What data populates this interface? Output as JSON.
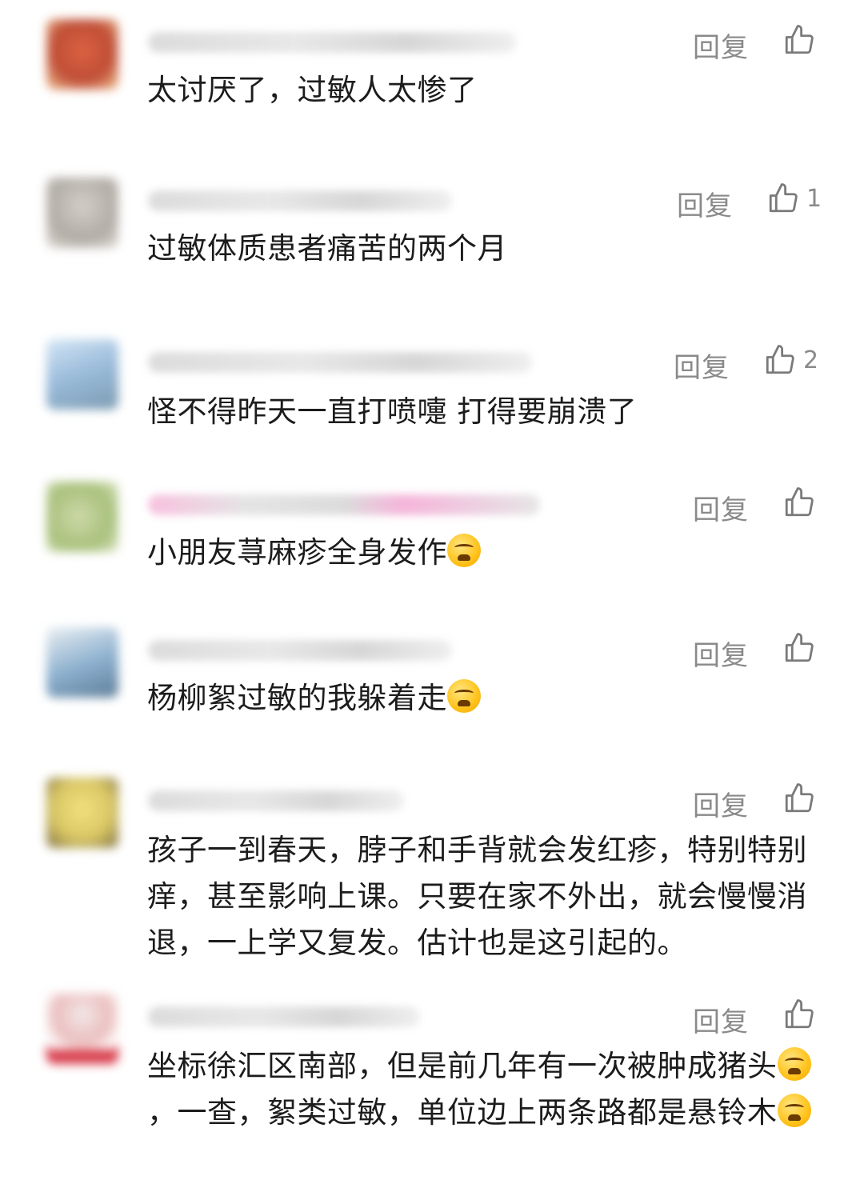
{
  "reply_label": "回复",
  "comments": [
    {
      "text": "太讨厌了，过敏人太惨了",
      "likes": "",
      "avatar_color": "#c0452c"
    },
    {
      "text": "过敏体质患者痛苦的两个月",
      "likes": "1",
      "avatar_color": "#b9b4ae"
    },
    {
      "text": "怪不得昨天一直打喷嚏 打得要崩溃了",
      "likes": "2",
      "avatar_color": "#8fb4d6"
    },
    {
      "text": "小朋友荨麻疹全身发作",
      "likes": "",
      "avatar_color": "#a8c07c",
      "emoji": "loudly-crying-face"
    },
    {
      "text": "杨柳絮过敏的我躲着走",
      "likes": "",
      "avatar_color": "#7fa7c9",
      "emoji": "crying-face"
    },
    {
      "text": "孩子一到春天，脖子和手背就会发红疹，特别特别痒，甚至影响上课。只要在家不外出，就会慢慢消退，一上学又复发。估计也是这引起的。",
      "likes": "",
      "avatar_color": "#d6c255"
    },
    {
      "text_part1": "坐标徐汇区南部，但是前几年有一次被肿成猪头",
      "text_part2": "，一查，絮类过敏，单位边上两条路都是悬铃木",
      "likes": "",
      "avatar_color": "#e9b7b7",
      "emoji1": "crying-face",
      "emoji2": "loudly-crying-face"
    }
  ]
}
